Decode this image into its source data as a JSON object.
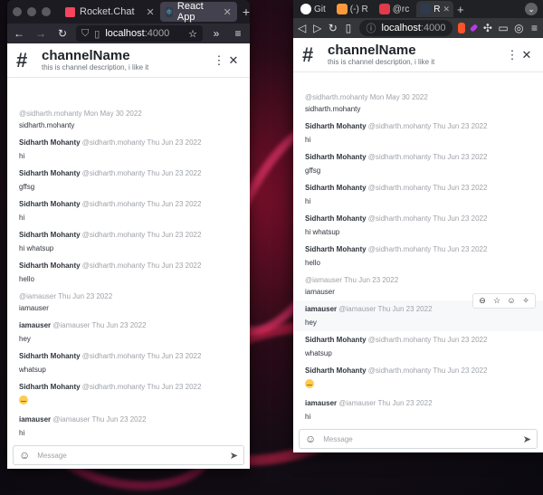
{
  "left_browser": {
    "tabs": [
      {
        "label": "Rocket.Chat",
        "icon_color": "#f5455c"
      },
      {
        "label": "React App",
        "icon_color": "#61dafb",
        "active": true
      }
    ],
    "url": {
      "host": "localhost",
      "port": ":4000"
    }
  },
  "right_browser": {
    "tabs": [
      "Git",
      "(-) R",
      "@rc",
      "R"
    ],
    "url": {
      "host": "localhost",
      "port": ":4000"
    }
  },
  "channel": {
    "name": "channelName",
    "description": "this is channel description, i like it",
    "hash_icon": "hash-icon"
  },
  "composer": {
    "placeholder": "Message"
  },
  "left_messages": [
    {
      "author": "",
      "username": "@sidharth.mohanty",
      "time": "Mon May 30 2022",
      "body": "sidharth.mohanty"
    },
    {
      "author": "Sidharth Mohanty",
      "username": "@sidharth.mohanty",
      "time": "Thu Jun 23 2022",
      "body": "hi"
    },
    {
      "author": "Sidharth Mohanty",
      "username": "@sidharth.mohanty",
      "time": "Thu Jun 23 2022",
      "body": "gffsg"
    },
    {
      "author": "Sidharth Mohanty",
      "username": "@sidharth.mohanty",
      "time": "Thu Jun 23 2022",
      "body": "hi"
    },
    {
      "author": "Sidharth Mohanty",
      "username": "@sidharth.mohanty",
      "time": "Thu Jun 23 2022",
      "body": "hi whatsup"
    },
    {
      "author": "Sidharth Mohanty",
      "username": "@sidharth.mohanty",
      "time": "Thu Jun 23 2022",
      "body": "hello"
    },
    {
      "author": "",
      "username": "@iamauser",
      "time": "Thu Jun 23 2022",
      "body": "iamauser"
    },
    {
      "author": "iamauser",
      "username": "@iamauser",
      "time": "Thu Jun 23 2022",
      "body": "hey"
    },
    {
      "author": "Sidharth Mohanty",
      "username": "@sidharth.mohanty",
      "time": "Thu Jun 23 2022",
      "body": "whatsup"
    },
    {
      "author": "Sidharth Mohanty",
      "username": "@sidharth.mohanty",
      "time": "Thu Jun 23 2022",
      "body": ""
    },
    {
      "author": "iamauser",
      "username": "@iamauser",
      "time": "Thu Jun 23 2022",
      "body": "hi"
    }
  ],
  "right_messages": [
    {
      "author": "",
      "username": "@sidharth.mohanty",
      "time": "Mon May 30 2022",
      "body": "sidharth.mohanty"
    },
    {
      "author": "Sidharth Mohanty",
      "username": "@sidharth.mohanty",
      "time": "Thu Jun 23 2022",
      "body": "hi"
    },
    {
      "author": "Sidharth Mohanty",
      "username": "@sidharth.mohanty",
      "time": "Thu Jun 23 2022",
      "body": "gffsg"
    },
    {
      "author": "Sidharth Mohanty",
      "username": "@sidharth.mohanty",
      "time": "Thu Jun 23 2022",
      "body": "hi"
    },
    {
      "author": "Sidharth Mohanty",
      "username": "@sidharth.mohanty",
      "time": "Thu Jun 23 2022",
      "body": "hi whatsup"
    },
    {
      "author": "Sidharth Mohanty",
      "username": "@sidharth.mohanty",
      "time": "Thu Jun 23 2022",
      "body": "hello"
    },
    {
      "author": "",
      "username": "@iamauser",
      "time": "Thu Jun 23 2022",
      "body": "iamauser"
    },
    {
      "author": "iamauser",
      "username": "@iamauser",
      "time": "Thu Jun 23 2022",
      "body": "hey"
    },
    {
      "author": "Sidharth Mohanty",
      "username": "@sidharth.mohanty",
      "time": "Thu Jun 23 2022",
      "body": "whatsup"
    },
    {
      "author": "Sidharth Mohanty",
      "username": "@sidharth.mohanty",
      "time": "Thu Jun 23 2022",
      "body": ""
    },
    {
      "author": "iamauser",
      "username": "@iamauser",
      "time": "Thu Jun 23 2022",
      "body": "hi"
    }
  ],
  "message_actions": [
    "reply-thread-icon",
    "star-icon",
    "emoji-icon",
    "pin-icon"
  ]
}
